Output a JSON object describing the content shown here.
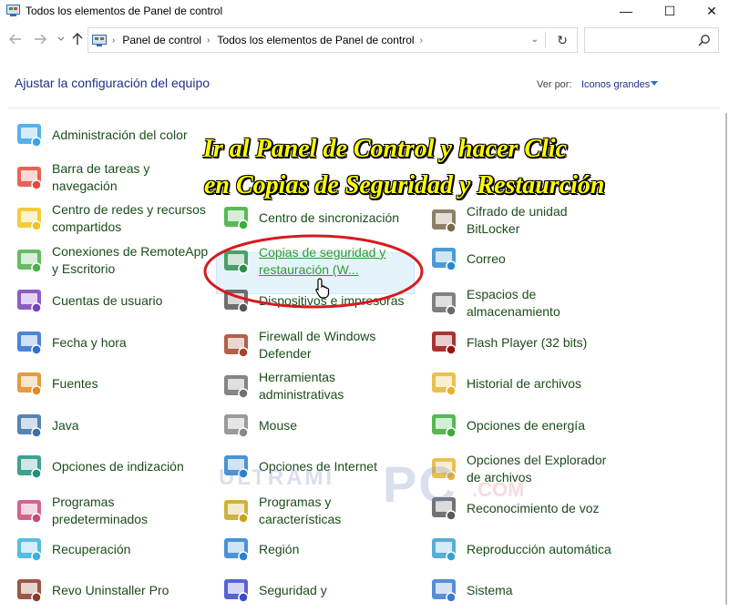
{
  "window": {
    "title": "Todos los elementos de Panel de control",
    "min_glyph": "—",
    "max_glyph": "☐",
    "close_glyph": "✕"
  },
  "address": {
    "crumbs": [
      "Panel de control",
      "Todos los elementos de Panel de control"
    ],
    "search_placeholder": ""
  },
  "header": {
    "title": "Ajustar la configuración del equipo",
    "view_by_label": "Ver por:",
    "view_by_value": "Iconos grandes"
  },
  "overlay": {
    "line1": "Ir al Panel de Control y hacer Clic",
    "line2": "en Copias de Seguridad y Restaurción"
  },
  "watermark": {
    "part1": "ULTRAMI",
    "part2": "PC",
    "part3": ".COM"
  },
  "columns": [
    {
      "items": [
        {
          "label": "Administración del color",
          "icon": "color-management-icon"
        },
        {
          "label": "Barra de tareas y navegación",
          "icon": "taskbar-icon"
        },
        {
          "label": "Centro de redes y recursos compartidos",
          "icon": "network-center-icon"
        },
        {
          "label": "Conexiones de RemoteApp y Escritorio",
          "icon": "remoteapp-icon"
        },
        {
          "label": "Cuentas de usuario",
          "icon": "user-accounts-icon"
        },
        {
          "label": "Fecha y hora",
          "icon": "date-time-icon"
        },
        {
          "label": "Fuentes",
          "icon": "fonts-icon"
        },
        {
          "label": "Java",
          "icon": "java-icon"
        },
        {
          "label": "Opciones de indización",
          "icon": "indexing-icon"
        },
        {
          "label": "Programas predeterminados",
          "icon": "default-programs-icon"
        },
        {
          "label": "Recuperación",
          "icon": "recovery-icon"
        },
        {
          "label": "Revo Uninstaller Pro",
          "icon": "revo-uninstaller-icon"
        }
      ]
    },
    {
      "items": [
        {
          "label": "Centro de sincronización",
          "icon": "sync-center-icon"
        },
        {
          "label": "Copias de seguridad y restauración (W...",
          "icon": "backup-restore-icon"
        },
        {
          "label": "Dispositivos e impresoras",
          "icon": "devices-printers-icon"
        },
        {
          "label": "Firewall de Windows Defender",
          "icon": "firewall-icon"
        },
        {
          "label": "Herramientas administrativas",
          "icon": "admin-tools-icon"
        },
        {
          "label": "Mouse",
          "icon": "mouse-icon"
        },
        {
          "label": "Opciones de Internet",
          "icon": "internet-options-icon"
        },
        {
          "label": "Programas y características",
          "icon": "programs-features-icon"
        },
        {
          "label": "Región",
          "icon": "region-icon"
        },
        {
          "label": "Seguridad y",
          "icon": "security-maintenance-icon"
        }
      ]
    },
    {
      "items": [
        {
          "label": "Cifrado de unidad BitLocker",
          "icon": "bitlocker-icon"
        },
        {
          "label": "Correo",
          "icon": "mail-icon"
        },
        {
          "label": "Espacios de almacenamiento",
          "icon": "storage-spaces-icon"
        },
        {
          "label": "Flash Player (32 bits)",
          "icon": "flash-player-icon"
        },
        {
          "label": "Historial de archivos",
          "icon": "file-history-icon"
        },
        {
          "label": "Opciones de energía",
          "icon": "power-options-icon"
        },
        {
          "label": "Opciones del Explorador de archivos",
          "icon": "explorer-options-icon"
        },
        {
          "label": "Reconocimiento de voz",
          "icon": "speech-recognition-icon"
        },
        {
          "label": "Reproducción automática",
          "icon": "autoplay-icon"
        },
        {
          "label": "Sistema",
          "icon": "system-icon"
        }
      ]
    }
  ]
}
